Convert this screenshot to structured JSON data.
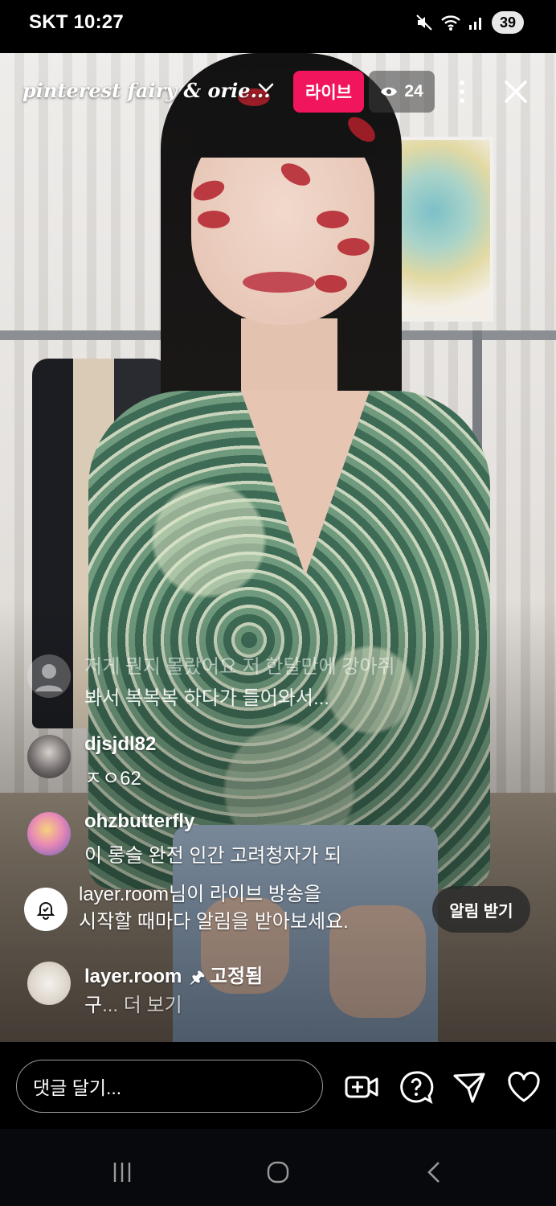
{
  "status_bar": {
    "carrier": "SKT",
    "time": "10:27",
    "battery": "39"
  },
  "header": {
    "title": "pinterest fairy & orie...",
    "live_label": "라이브",
    "viewers": "24"
  },
  "comments": [
    {
      "line1": "저게 뭔지 몰랐어요 저 한달만에 강아쥐",
      "line2": "봐서 복복복 하다가 들어와서..."
    },
    {
      "user": "djsjdl82",
      "text": "ㅈㅇ62"
    },
    {
      "user": "ohzbutterfly",
      "text": "이 롱슬 완전 인간 고려청자가 되"
    }
  ],
  "notification": {
    "line1": "layer.room님이 라이브 방송을",
    "line2": "시작할 때마다 알림을 받아보세요.",
    "button": "알림 받기"
  },
  "pinned": {
    "user": "layer.room",
    "pin_glyph": "🖈",
    "pinned_label": "고정됨",
    "text_start": "구",
    "more": "... 더 보기"
  },
  "bottom_bar": {
    "comment_placeholder": "댓글 달기..."
  },
  "icons": {
    "header": [
      "chevron-down-icon",
      "eye-icon",
      "more-vertical-icon",
      "close-icon"
    ],
    "bottom": [
      "add-video-icon",
      "question-icon",
      "send-icon",
      "heart-icon"
    ],
    "nav": [
      "recent-apps-icon",
      "home-icon",
      "back-icon"
    ]
  },
  "colors": {
    "live_badge": "#f0155c",
    "background": "#000000"
  }
}
